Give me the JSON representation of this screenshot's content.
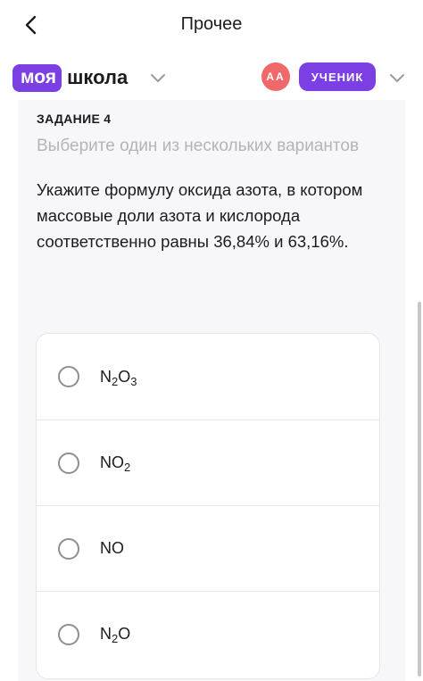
{
  "header": {
    "title": "Прочее",
    "back_icon": "chevron-left-icon"
  },
  "brand": {
    "logo_part1": "моя",
    "logo_part2": "школа",
    "accent_color": "#7b3fe4"
  },
  "user": {
    "initials": "АА",
    "role": "УЧЕНИК",
    "avatar_color": "#f0686a"
  },
  "task": {
    "label": "ЗАДАНИЕ 4",
    "hint": "Выберите один из нескольких вариантов",
    "question": "Укажите формулу оксида азота, в котором массовые доли азота и кислорода соответственно равны 36,84% и 63,16%."
  },
  "options": [
    {
      "text": "N2O3",
      "selected": false
    },
    {
      "text": "NO2",
      "selected": false
    },
    {
      "text": "NO",
      "selected": false
    },
    {
      "text": "N2O",
      "selected": false
    }
  ]
}
